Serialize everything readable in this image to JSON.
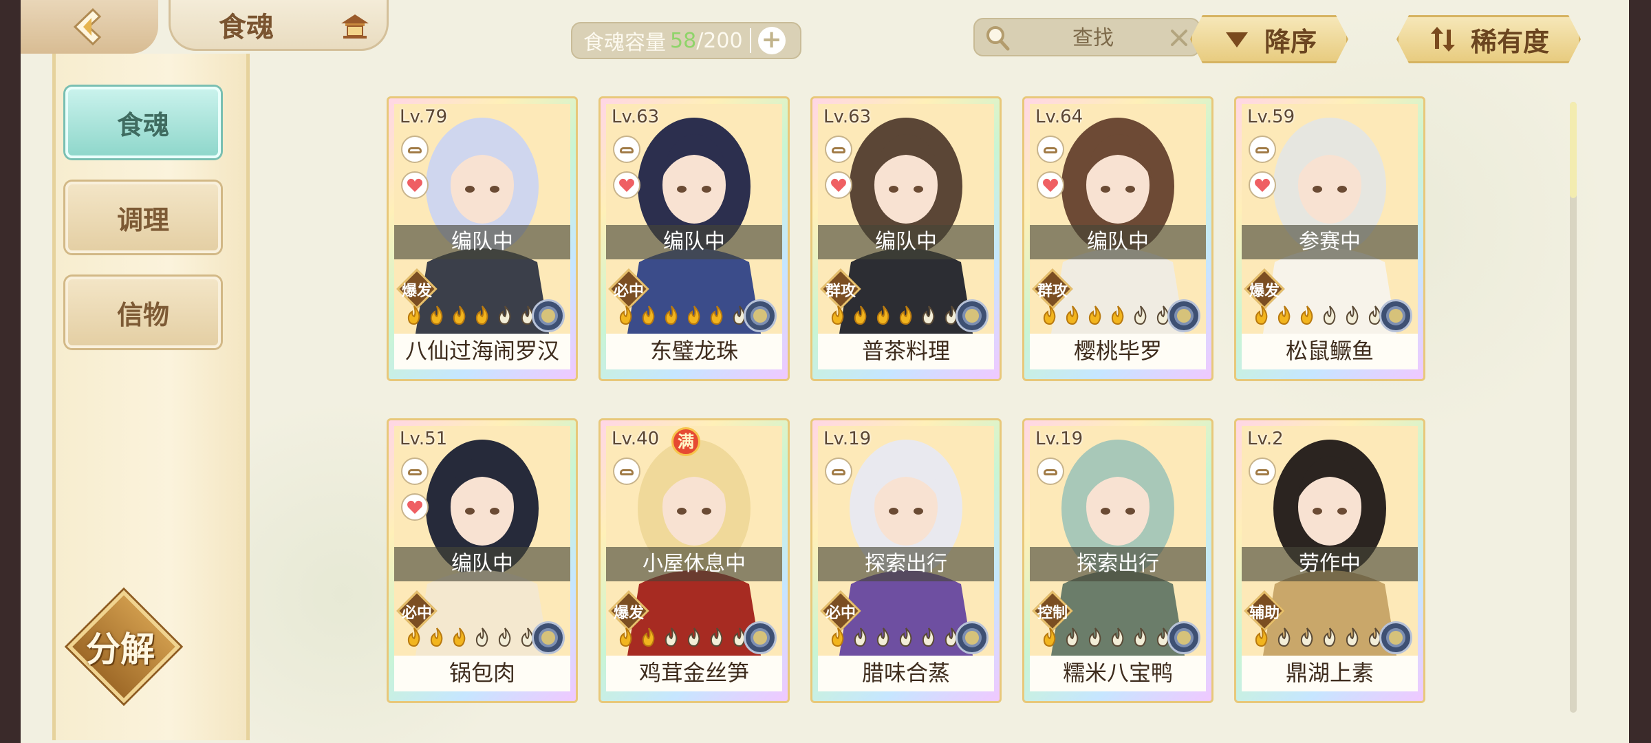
{
  "header": {
    "title": "食魂",
    "capacity": {
      "label": "食魂容量",
      "used": "58",
      "total": "/200"
    },
    "search": {
      "placeholder": "查找"
    },
    "sort_button": "降序",
    "filter_button": "稀有度"
  },
  "sidebar": {
    "items": [
      {
        "label": "食魂",
        "active": true
      },
      {
        "label": "调理",
        "active": false
      },
      {
        "label": "信物",
        "active": false
      }
    ],
    "decompose_label": "分解"
  },
  "cards": [
    {
      "level": "Lv.79",
      "status": "编队中",
      "tag": "爆发",
      "name": "八仙过海闹罗汉",
      "stars": 4,
      "colors": [
        "#cfd6ee",
        "#3b3f4a"
      ]
    },
    {
      "level": "Lv.63",
      "status": "编队中",
      "tag": "必中",
      "name": "东璧龙珠",
      "stars": 5,
      "colors": [
        "#2c2f4e",
        "#3b4c8a"
      ]
    },
    {
      "level": "Lv.63",
      "status": "编队中",
      "tag": "群攻",
      "name": "普茶料理",
      "stars": 4,
      "colors": [
        "#5b4636",
        "#2c2d33"
      ]
    },
    {
      "level": "Lv.64",
      "status": "编队中",
      "tag": "群攻",
      "name": "樱桃毕罗",
      "stars": 4,
      "colors": [
        "#6d4a35",
        "#f0ece2"
      ]
    },
    {
      "level": "Lv.59",
      "status": "参赛中",
      "tag": "爆发",
      "name": "松鼠鳜鱼",
      "stars": 3,
      "colors": [
        "#e6e6e0",
        "#f7f3ea"
      ]
    },
    {
      "level": "Lv.51",
      "status": "编队中",
      "tag": "必中",
      "name": "锅包肉",
      "stars": 3,
      "colors": [
        "#262a3a",
        "#f4e8cf"
      ]
    },
    {
      "level": "Lv.40",
      "status": "小屋休息中",
      "tag": "爆发",
      "name": "鸡茸金丝笋",
      "stars": 2,
      "colors": [
        "#f0d99a",
        "#a72b22"
      ],
      "full_badge": "满"
    },
    {
      "level": "Lv.19",
      "status": "探索出行",
      "tag": "必中",
      "name": "腊味合蒸",
      "stars": 1,
      "colors": [
        "#e9e9ef",
        "#6e4fa1"
      ]
    },
    {
      "level": "Lv.19",
      "status": "探索出行",
      "tag": "控制",
      "name": "糯米八宝鸭",
      "stars": 1,
      "colors": [
        "#a8c8b8",
        "#6b7d6a"
      ]
    },
    {
      "level": "Lv.2",
      "status": "劳作中",
      "tag": "辅助",
      "name": "鼎湖上素",
      "stars": 1,
      "colors": [
        "#2b2420",
        "#c9a76a"
      ]
    }
  ]
}
